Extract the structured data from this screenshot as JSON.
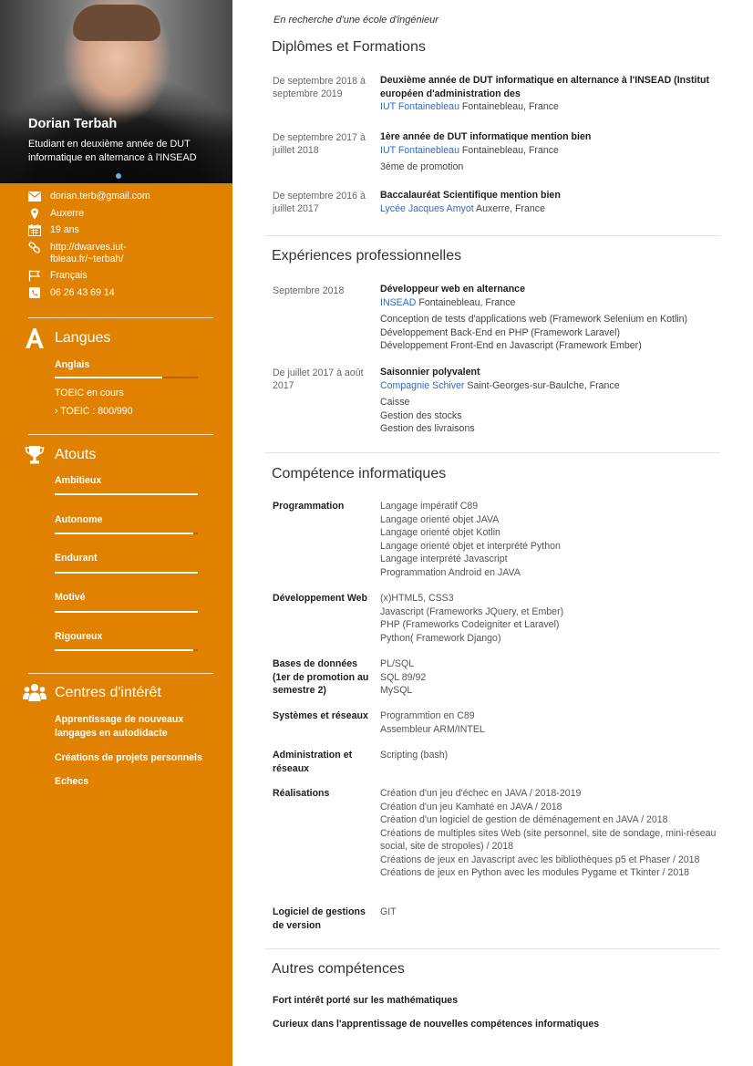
{
  "profile": {
    "name": "Dorian Terbah",
    "tagline": "Etudiant en deuxième année de DUT informatique en alternance à l'INSEAD",
    "subtitle": "En recherche d'une école d'ingénieur"
  },
  "contact": {
    "email": "dorian.terb@gmail.com",
    "city": "Auxerre",
    "age": "19 ans",
    "website": "http://dwarves.iut-fbleau.fr/~terbah/",
    "nationality": "Français",
    "phone": "06 26 43 69 14"
  },
  "languages": {
    "heading": "Langues",
    "items": [
      {
        "name": "Anglais",
        "level": 0.75
      }
    ],
    "notes": [
      "TOEIC en cours",
      "› TOEIC : 800/990"
    ]
  },
  "assets": {
    "heading": "Atouts",
    "items": [
      {
        "name": "Ambitieux",
        "level": 1.0
      },
      {
        "name": "Autonome",
        "level": 0.97
      },
      {
        "name": "Endurant",
        "level": 1.0
      },
      {
        "name": "Motivé",
        "level": 1.0
      },
      {
        "name": "Rigoureux",
        "level": 0.97
      }
    ]
  },
  "interests": {
    "heading": "Centres d'intérêt",
    "items": [
      "Apprentissage de nouveaux langages en autodidacte",
      "Créations de projets personnels",
      "Echecs"
    ]
  },
  "education": {
    "heading": "Diplômes et Formations",
    "entries": [
      {
        "date": "De septembre 2018 à septembre 2019",
        "title": "Deuxième année de DUT informatique en alternance à l'INSEAD (Institut européen d'administration des",
        "school": "IUT Fontainebleau",
        "place": " Fontainebleau, France",
        "note": ""
      },
      {
        "date": "De septembre 2017 à juillet 2018",
        "title": "1ère année de DUT informatique mention bien",
        "school": "IUT Fontainebleau",
        "place": " Fontainebleau, France",
        "note": "3ème de promotion"
      },
      {
        "date": "De septembre 2016 à juillet 2017",
        "title": "Baccalauréat Scientifique mention bien",
        "school": "Lycée Jacques Amyot",
        "place": " Auxerre, France",
        "note": ""
      }
    ]
  },
  "experience": {
    "heading": "Expériences professionnelles",
    "entries": [
      {
        "date": "Septembre 2018",
        "title": "Développeur web en alternance",
        "company": "INSEAD",
        "place": " Fontainebleau, France",
        "tasks": [
          "Conception de tests d'applications web (Framework Selenium en Kotlin)",
          "Développement Back-End en PHP (Framework Laravel)",
          "Développement Front-End en Javascript (Framework Ember)"
        ]
      },
      {
        "date": "De juillet 2017 à août 2017",
        "title": "Saisonnier polyvalent",
        "company": "Compagnie Schiver",
        "place": " Saint-Georges-sur-Baulche, France",
        "tasks": [
          "Caisse",
          "Gestion des stocks",
          "Gestion des livraisons"
        ]
      }
    ]
  },
  "skills": {
    "heading": "Compétence informatiques",
    "rows": [
      {
        "label": "Programmation",
        "values": [
          "Langage impératif C89",
          "Langage orienté objet JAVA",
          "Langage orienté objet Kotlin",
          "Langage orienté objet et interprété Python",
          "Langage interprété Javascript",
          "Programmation Android en JAVA"
        ]
      },
      {
        "label": "Développement Web",
        "values": [
          "(x)HTML5, CSS3",
          "Javascript (Frameworks JQuery, et Ember)",
          "PHP (Frameworks Codeigniter et Laravel)",
          "Python( Framework Django)"
        ]
      },
      {
        "label": "Bases de données (1er de promotion au semestre 2)",
        "values": [
          "PL/SQL",
          "SQL 89/92",
          "MySQL"
        ]
      },
      {
        "label": "Systèmes et réseaux",
        "values": [
          "Programmtion en C89",
          "Assembleur ARM/INTEL"
        ]
      },
      {
        "label": "Administration et réseaux",
        "values": [
          "Scripting (bash)"
        ]
      },
      {
        "label": "Réalisations",
        "values": [
          "Création d'un jeu d'échec  en JAVA / 2018-2019",
          "Création d'un jeu Kamhaté en JAVA / 2018",
          "Création d'un logiciel de gestion de déménagement en JAVA / 2018",
          "Créations de multiples sites Web (site personnel, site de sondage, mini-réseau social, site de stropoles) / 2018",
          "Créations de jeux en Javascript avec les bibliothèques p5 et Phaser / 2018",
          "Créations de jeux en Python avec les modules Pygame et Tkinter / 2018"
        ]
      },
      {
        "label": "Logiciel de gestions de version",
        "values": [
          "GIT"
        ]
      }
    ]
  },
  "other_skills": {
    "heading": "Autres compétences",
    "items": [
      "Fort intérêt porté sur les mathématiques",
      "Curieux dans l'apprentissage de nouvelles compétences informatiques"
    ]
  },
  "colors": {
    "sidebar": "#E08200",
    "link": "#2f6bc1"
  },
  "icons": [
    "envelope-icon",
    "map-pin-icon",
    "calendar-icon",
    "link-icon",
    "flag-icon",
    "phone-icon",
    "letter-a-icon",
    "trophy-icon",
    "people-icon"
  ]
}
